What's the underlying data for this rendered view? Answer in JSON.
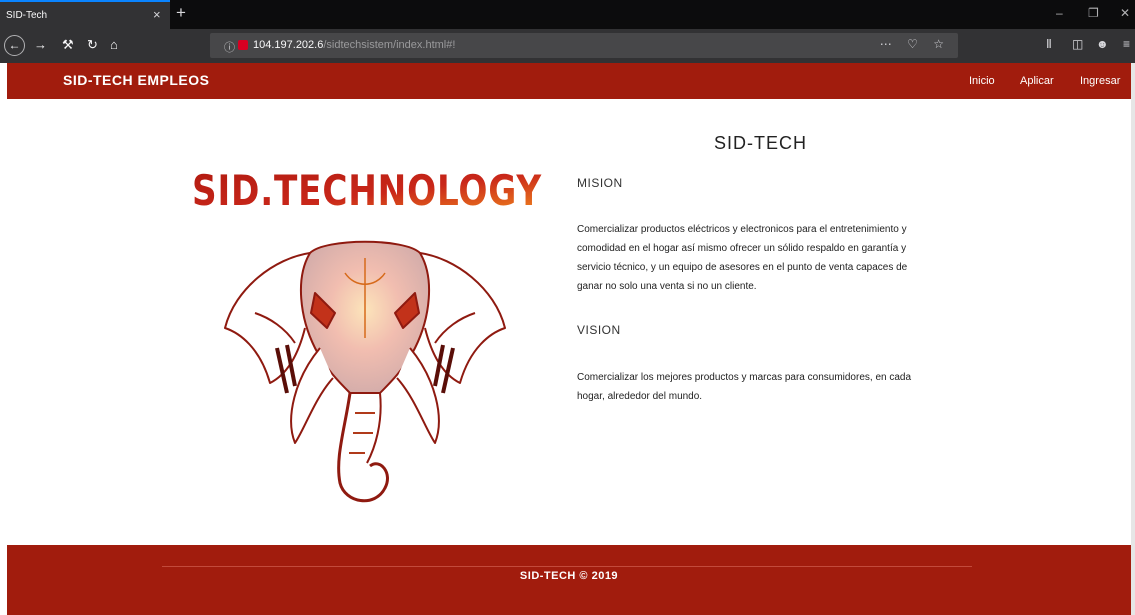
{
  "browser": {
    "tab_title": "SID-Tech",
    "tab_close": "×",
    "new_tab": "+",
    "url_main": "104.197.202.6",
    "url_path": "/sidtechsistem/index.html#!",
    "icons": [
      "back-icon",
      "forward-icon",
      "wrench-icon",
      "reload-icon",
      "home-icon",
      "info-icon",
      "lock-icon",
      "more-icon",
      "pocket-icon",
      "bookmark-star-icon",
      "library-icon",
      "sidebar-icon",
      "account-icon",
      "menu-icon",
      "minimize-icon",
      "restore-icon",
      "close-icon"
    ]
  },
  "header": {
    "brand": "SID-TECH EMPLEOS",
    "nav": [
      "Inicio",
      "Aplicar",
      "Ingresar"
    ]
  },
  "hero": {
    "logo_text": "SID.TECHNOLOGY",
    "title": "SID-TECH"
  },
  "mission": {
    "heading": "MISION",
    "lines": [
      "Comercializar productos eléctricos y electronicos para el entretenimiento y",
      "comodidad en el hogar así mismo ofrecer un sólido respaldo en garantía y",
      "servicio técnico, y un equipo de asesores en el punto de venta capaces de",
      "ganar no solo una venta si no un cliente."
    ]
  },
  "vision": {
    "heading": "VISION",
    "lines": [
      "Comercializar los mejores productos y marcas para consumidores, en cada",
      "hogar, alrededor del mundo."
    ]
  },
  "footer": {
    "text": "SID-TECH © 2019"
  },
  "colors": {
    "brand_red": "#a11c0d",
    "logo_red": "#b01a10",
    "logo_orange": "#f28a1e"
  }
}
